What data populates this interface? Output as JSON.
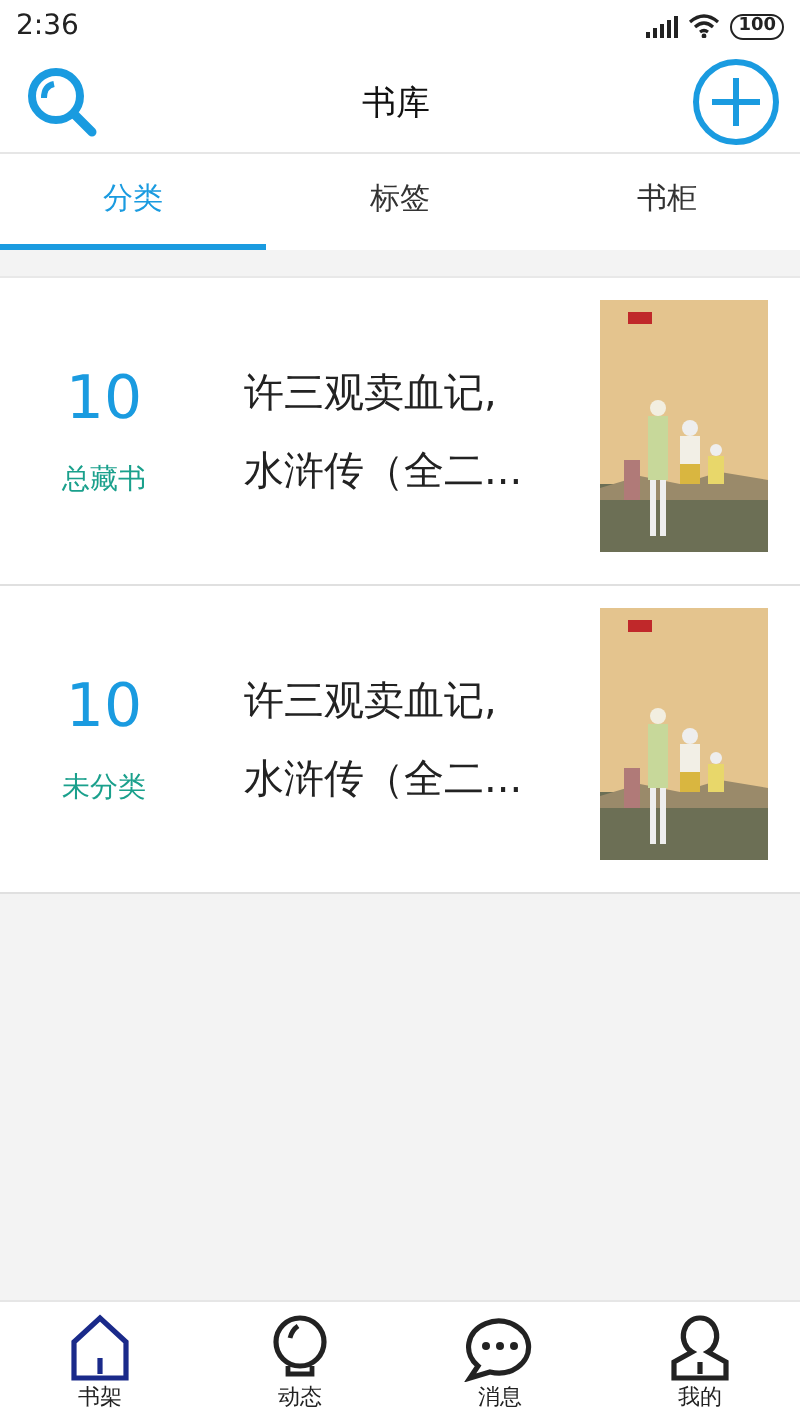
{
  "status_bar": {
    "time": "2:36",
    "battery": "100"
  },
  "header": {
    "title": "书库"
  },
  "tabs": [
    {
      "label": "分类",
      "selected": true
    },
    {
      "label": "标签",
      "selected": false
    },
    {
      "label": "书柜",
      "selected": false
    }
  ],
  "cards": [
    {
      "count": "10",
      "label": "总藏书",
      "title_lines": [
        "许三观卖血记,",
        "水浒传（全二..."
      ],
      "cover": {
        "kind": "picture"
      }
    },
    {
      "count": "10",
      "label": "未分类",
      "title_lines": [
        "许三观卖血记,",
        "水浒传（全二..."
      ],
      "cover": {
        "kind": "picture"
      }
    }
  ],
  "bottom_nav": [
    {
      "kind": "home",
      "label": "书架",
      "selected": true
    },
    {
      "kind": "bulb",
      "label": "动态",
      "selected": false
    },
    {
      "kind": "chat",
      "label": "消息",
      "selected": false
    },
    {
      "kind": "person",
      "label": "我的",
      "selected": false
    }
  ]
}
